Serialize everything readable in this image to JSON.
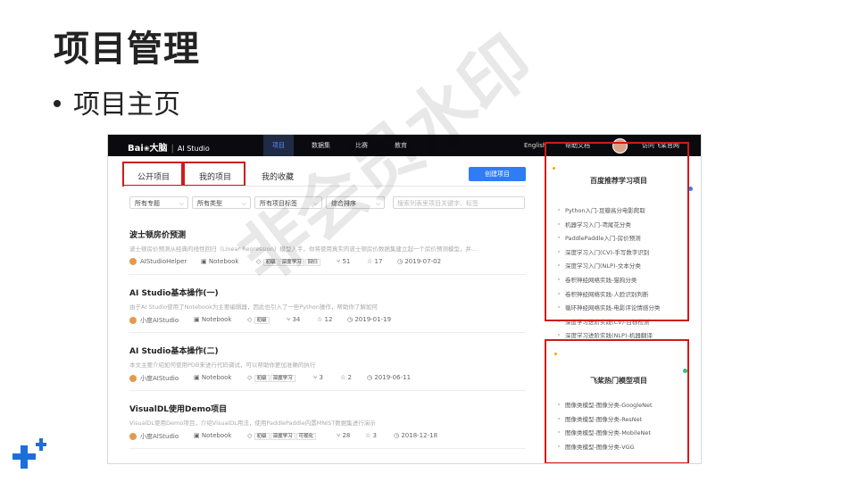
{
  "slide": {
    "title": "项目管理",
    "bullet": "项目主页",
    "watermark": "非会员水印"
  },
  "screenshot": {
    "topbar": {
      "brand": "Bai",
      "brand_cn": "大脑",
      "brand_sep": "|",
      "product": "AI Studio",
      "nav": [
        "项目",
        "数据集",
        "比赛",
        "教育"
      ],
      "active_nav": "项目",
      "lang": "English",
      "help": "帮助文档",
      "visit": "访问飞桨官网"
    },
    "tabs": [
      "公开项目",
      "我的项目",
      "我的收藏"
    ],
    "create_button": "创建项目",
    "filters": [
      "所有专题",
      "所有类型",
      "所有项目标签",
      "综合排序"
    ],
    "search_placeholder": "搜索列表里项目关键字、标签",
    "projects": [
      {
        "title": "波士顿房价预测",
        "desc": "波士顿房价预测从经典的线性回归（Linear Regression）模型入手，你将使用真实的波士顿房价数据集建立起一个房价预测模型，并...",
        "author": "AIStudioHelper",
        "type": "Notebook",
        "tags": [
          "初级",
          "深度学习",
          "回归"
        ],
        "forks": "51",
        "stars": "17",
        "date": "2019-07-02"
      },
      {
        "title": "AI Studio基本操作(一)",
        "desc": "由于AI Studio使用了Notebook为主要编辑器，因此也引入了一些Python操作，帮助你了解如何",
        "author": "小度AIStudio",
        "type": "Notebook",
        "tags": [
          "初级"
        ],
        "forks": "34",
        "stars": "12",
        "date": "2019-01-19"
      },
      {
        "title": "AI Studio基本操作(二)",
        "desc": "本文主要介绍如何使用PDB来进行代码调试，可以帮助你更加准确的执行",
        "author": "小度AIStudio",
        "type": "Notebook",
        "tags": [
          "初级",
          "深度学习"
        ],
        "forks": "3",
        "stars": "2",
        "date": "2019-06-11"
      },
      {
        "title": "VisualDL使用Demo项目",
        "desc": "VisualDL使用Demo项目，介绍VisualDL用法，使用PaddlePaddle内置MNIST数据集进行演示",
        "author": "小度AIStudio",
        "type": "Notebook",
        "tags": [
          "初级",
          "深度学习",
          "可视化"
        ],
        "forks": "28",
        "stars": "3",
        "date": "2018-12-18"
      }
    ],
    "sidebar": {
      "recommend_title": "百度推荐学习项目",
      "recommend_items": [
        "Python入门-豆瓣高分电影爬取",
        "机器学习入门-鸢尾花分类",
        "PaddlePaddle入门-房价预测",
        "深度学习入门(CV)-手写数字识别",
        "深度学习入门(NLP)-文本分类",
        "卷积神经网络实践-猫狗分类",
        "卷积神经网络实践-人脸识别判断",
        "循环神经网络实践-电影评论情感分类",
        "深度学习进阶实践(CV)-目标检测",
        "深度学习进阶实践(NLP)-机器翻译"
      ],
      "hot_title": "飞桨热门模型项目",
      "hot_items": [
        "图像类模型-图像分类-GoogleNet",
        "图像类模型-图像分类-ResNet",
        "图像类模型-图像分类-MobileNet",
        "图像类模型-图像分类-VGG"
      ]
    }
  },
  "colors": {
    "highlight": "#d01a1a",
    "primary": "#2f7cf6",
    "topbar": "#0b0b0f",
    "logo": "#1a6fd8"
  },
  "icons": [
    "logo-cross-icon",
    "fork-icon",
    "star-icon",
    "clock-icon",
    "tag-icon",
    "notebook-icon",
    "chevron-down-icon"
  ]
}
